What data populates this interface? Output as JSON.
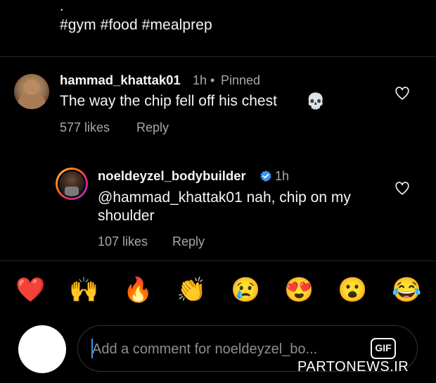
{
  "caption": {
    "dot": ".",
    "hashtags": "#gym #food #mealprep"
  },
  "comments": [
    {
      "username": "hammad_khattak01",
      "time": "1h",
      "separator": "•",
      "pinned": "Pinned",
      "text": "The way the chip fell off his chest",
      "emoji": "💀",
      "likes": "577 likes",
      "reply_label": "Reply"
    }
  ],
  "replies": [
    {
      "username": "noeldeyzel_bodybuilder",
      "verified": true,
      "time": "1h",
      "text_line1": "@hammad_khattak01 nah, chip on my",
      "text_line2": "shoulder",
      "likes": "107 likes",
      "reply_label": "Reply"
    }
  ],
  "emoji_bar": [
    "❤️",
    "🙌",
    "🔥",
    "👏",
    "😢",
    "😍",
    "😮",
    "😂"
  ],
  "composer": {
    "placeholder": "Add a comment for noeldeyzel_bo...",
    "gif_label": "GIF"
  },
  "watermark": "PARTONEWS.IR",
  "colors": {
    "background": "#000000",
    "primary_text": "#f5f5f5",
    "secondary_text": "#a8a8a8",
    "verified_blue": "#3897f0"
  }
}
